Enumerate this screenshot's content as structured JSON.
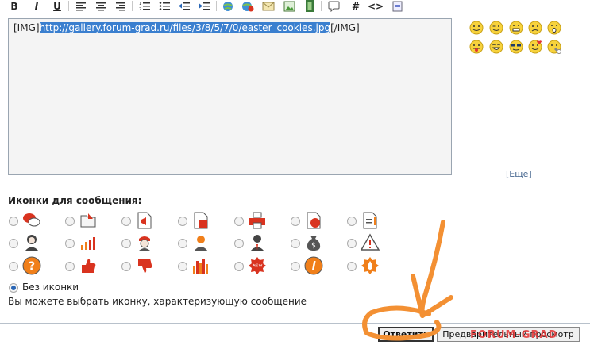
{
  "editor": {
    "open_tag": "[IMG]",
    "url": "http://gallery.forum-grad.ru/files/3/8/5/7/0/easter_cookies.jpg",
    "close_tag": "[/IMG]"
  },
  "toolbar": {
    "bold": "B",
    "italic": "I",
    "underline": "U",
    "hash": "#",
    "code": "<>"
  },
  "smilies": {
    "more_open": "[",
    "more": "Ещё",
    "more_close": "]"
  },
  "post_icons": {
    "title": "Иконки для сообщения:",
    "no_icon_label": "Без иконки",
    "hint": "Вы можете выбрать иконку, характеризующую сообщение"
  },
  "buttons": {
    "reply": "Ответить",
    "preview": "Предварительный просмотр"
  },
  "watermark": "FORUM-GRAD",
  "colors": {
    "link_highlight": "#3a7fcf",
    "editor_bg": "#f4f4f4",
    "icon_red": "#d9331f",
    "icon_orange": "#f07f1a",
    "arrow_orange": "#f39033"
  }
}
